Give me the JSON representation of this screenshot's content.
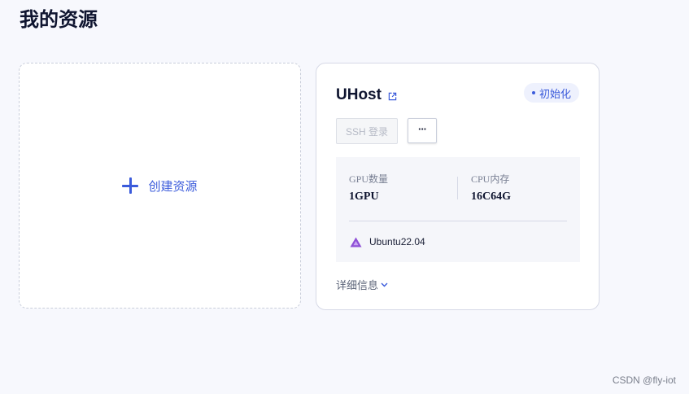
{
  "page": {
    "title": "我的资源"
  },
  "create_card": {
    "label": "创建资源",
    "icon": "plus-icon"
  },
  "host_card": {
    "name": "UHost",
    "name_icon": "external-link-icon",
    "status": "初始化",
    "ssh_button_label": "SSH 登录",
    "more_button_label": "···",
    "specs": [
      {
        "label": "GPU数量",
        "value": "1GPU"
      },
      {
        "label": "CPU内存",
        "value": "16C64G"
      }
    ],
    "os": {
      "icon": "os-logo-icon",
      "name": "Ubuntu22.04"
    },
    "details_label": "详细信息"
  },
  "colors": {
    "accent": "#3b5bdb",
    "background": "#f7f8fd",
    "os_logo": "#8e4fd6"
  },
  "watermark": "CSDN @fly-iot"
}
